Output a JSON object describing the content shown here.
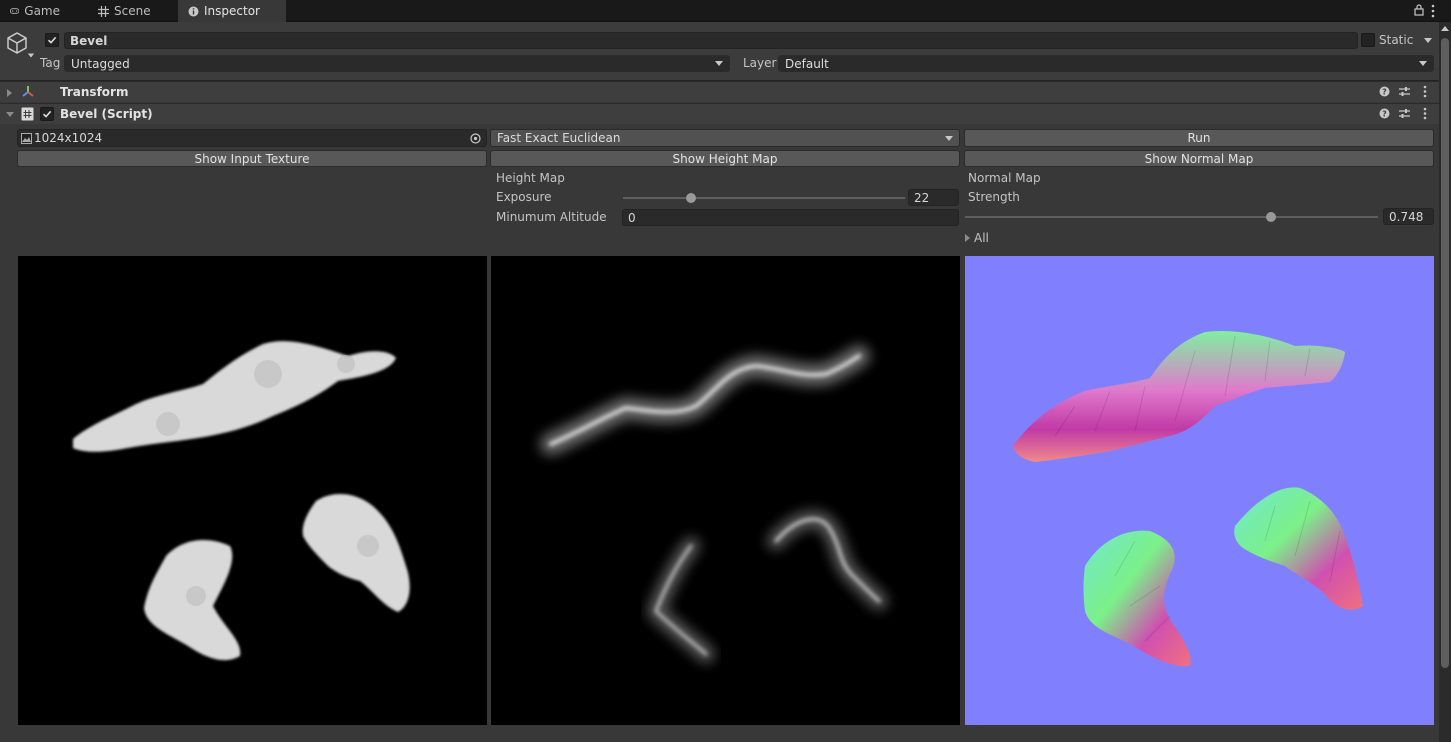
{
  "tabs": [
    {
      "label": "Game",
      "icon": "gamepad-icon"
    },
    {
      "label": "Scene",
      "icon": "grid-icon"
    },
    {
      "label": "Inspector",
      "icon": "info-icon",
      "active": true
    }
  ],
  "header": {
    "object_name": "Bevel",
    "static_label": "Static",
    "tag_label": "Tag",
    "tag_value": "Untagged",
    "layer_label": "Layer",
    "layer_value": "Default"
  },
  "components": {
    "transform": {
      "title": "Transform"
    },
    "bevel": {
      "title": "Bevel (Script)"
    }
  },
  "bevel": {
    "texture_field": "1024x1024",
    "algorithm": "Fast Exact Euclidean",
    "run_label": "Run",
    "show_input_label": "Show Input Texture",
    "show_height_label": "Show Height Map",
    "show_normal_label": "Show Normal Map",
    "height_map": {
      "section_label": "Height Map",
      "exposure_label": "Exposure",
      "exposure_value": "22",
      "exposure_fraction": 0.23,
      "min_altitude_label": "Minumum Altitude",
      "min_altitude_value": "0"
    },
    "normal_map": {
      "section_label": "Normal Map",
      "strength_label": "Strength",
      "strength_value": "0.748",
      "strength_fraction": 0.748,
      "all_label": "All"
    }
  },
  "colors": {
    "normal_map_background": "#8080ff",
    "panel_background": "#383838",
    "tab_bar": "#191919"
  }
}
